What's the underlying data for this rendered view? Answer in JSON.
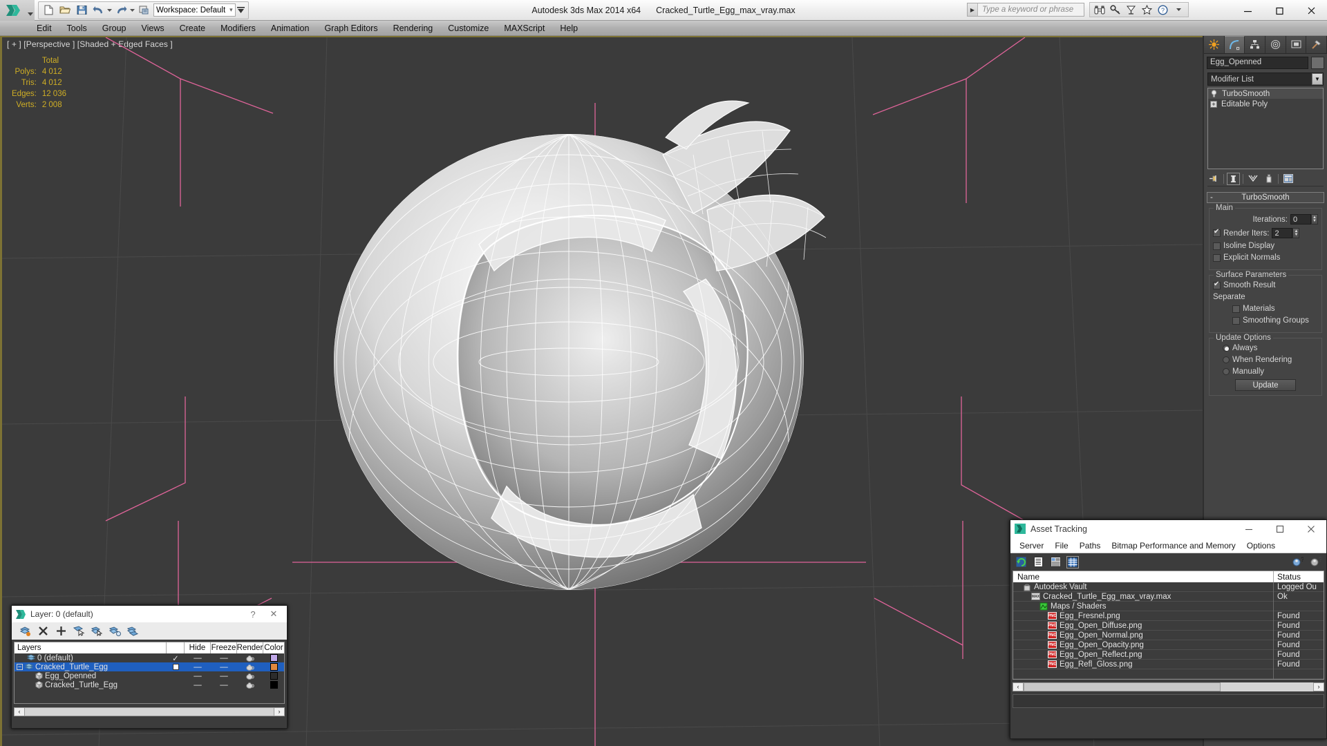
{
  "titlebar": {
    "app_title": "Autodesk 3ds Max  2014 x64",
    "file_title": "Cracked_Turtle_Egg_max_vray.max",
    "workspace_label": "Workspace: Default",
    "search_placeholder": "Type a keyword or phrase",
    "quick_access": [
      {
        "name": "new-file",
        "glyph": "new"
      },
      {
        "name": "open-file",
        "glyph": "open"
      },
      {
        "name": "save-file",
        "glyph": "save"
      },
      {
        "name": "undo",
        "glyph": "undo"
      },
      {
        "name": "redo",
        "glyph": "redo"
      },
      {
        "name": "set-project-folder",
        "glyph": "project"
      }
    ],
    "help_icons": [
      "binoculars-icon",
      "key-icon",
      "satellite-icon",
      "star-icon",
      "help-icon"
    ],
    "window_controls": [
      "minimize",
      "maximize",
      "close"
    ]
  },
  "menubar": {
    "items": [
      "Edit",
      "Tools",
      "Group",
      "Views",
      "Create",
      "Modifiers",
      "Animation",
      "Graph Editors",
      "Rendering",
      "Customize",
      "MAXScript",
      "Help"
    ]
  },
  "viewport": {
    "label": "[ + ] [Perspective ] [Shaded + Edged Faces ]",
    "stats_header": "Total",
    "stats": [
      {
        "label": "Polys:",
        "value": "4 012"
      },
      {
        "label": "Tris:",
        "value": "4 012"
      },
      {
        "label": "Edges:",
        "value": "12 036"
      },
      {
        "label": "Verts:",
        "value": "2 008"
      }
    ],
    "stats_color": "#cfae25",
    "background_color": "#3b3b3b",
    "grid_color": "#4a4a4a",
    "highlight_color": "#e0649a"
  },
  "command_panel": {
    "tabs": [
      "create-tab",
      "modify-tab",
      "hierarchy-tab",
      "motion-tab",
      "display-tab",
      "utilities-tab"
    ],
    "selected_tab_index": 1,
    "object_name": "Egg_Openned",
    "modifier_list_label": "Modifier List",
    "stack": [
      {
        "label": "TurboSmooth",
        "selected": true
      },
      {
        "label": "Editable Poly",
        "selected": false
      }
    ],
    "stack_buttons": [
      "pin-stack-icon",
      "show-end-result-icon",
      "make-unique-icon",
      "remove-modifier-icon",
      "configure-modifier-sets-icon"
    ],
    "rollout": {
      "title": "TurboSmooth",
      "collapse_glyph": "-",
      "main_group": "Main",
      "iterations_label": "Iterations:",
      "iterations_value": "0",
      "render_iters_label": "Render Iters:",
      "render_iters_value": "2",
      "render_iters_checked": true,
      "isoline_label": "Isoline Display",
      "isoline_checked": false,
      "explicit_normals_label": "Explicit Normals",
      "explicit_normals_checked": false,
      "surface_group": "Surface Parameters",
      "smooth_result_label": "Smooth Result",
      "smooth_result_checked": true,
      "separate_label": "Separate",
      "materials_label": "Materials",
      "materials_checked": false,
      "smoothing_groups_label": "Smoothing Groups",
      "smoothing_groups_checked": false,
      "update_group": "Update Options",
      "update_options": [
        {
          "label": "Always",
          "selected": true
        },
        {
          "label": "When Rendering",
          "selected": false
        },
        {
          "label": "Manually",
          "selected": false
        }
      ],
      "update_button": "Update"
    }
  },
  "layer_dialog": {
    "title": "Layer: 0 (default)",
    "help_glyph": "?",
    "close_glyph": "✕",
    "tools": [
      "create-new-layer-icon",
      "delete-layer-icon",
      "add-selection-icon",
      "select-objects-in-layer-icon",
      "select-highlighted-objects-icon",
      "highlight-selected-objects-icon",
      "layer-properties-icon"
    ],
    "columns": [
      "Layers",
      "",
      "Hide",
      "Freeze",
      "Render",
      "Color"
    ],
    "rows": [
      {
        "name": "0 (default)",
        "indent": 1,
        "type": "layer",
        "current": true,
        "hide": "—",
        "freeze": "—",
        "render": "teapot",
        "color": "#c0a8e8",
        "selected": false
      },
      {
        "name": "Cracked_Turtle_Egg",
        "indent": 0,
        "type": "layer",
        "current": false,
        "hide": "—",
        "freeze": "—",
        "render": "teapot",
        "color": "#e08840",
        "selected": true,
        "expand": "−"
      },
      {
        "name": "Egg_Openned",
        "indent": 2,
        "type": "object",
        "hide": "—",
        "freeze": "—",
        "render": "teapot",
        "color": "#2c2c2c",
        "selected": false
      },
      {
        "name": "Cracked_Turtle_Egg",
        "indent": 2,
        "type": "object",
        "hide": "—",
        "freeze": "—",
        "render": "teapot",
        "color": "#000000",
        "selected": false
      }
    ]
  },
  "asset_tracking": {
    "title": "Asset Tracking",
    "menu": [
      "Server",
      "File",
      "Paths",
      "Bitmap Performance and Memory",
      "Options"
    ],
    "toolbar": [
      "refresh-icon",
      "list-view-icon",
      "details-view-icon",
      "grid-view-icon"
    ],
    "toolbar_selected_index": 3,
    "toolbar_right": [
      "vault-login-icon",
      "vault-help-icon"
    ],
    "columns": [
      "Name",
      "Status"
    ],
    "rows": [
      {
        "name": "Autodesk Vault",
        "status": "Logged Ou",
        "indent": 0,
        "icon": "vault-icon"
      },
      {
        "name": "Cracked_Turtle_Egg_max_vray.max",
        "status": "Ok",
        "indent": 1,
        "icon": "max-file-icon"
      },
      {
        "name": "Maps / Shaders",
        "status": "",
        "indent": 2,
        "icon": "maps-icon"
      },
      {
        "name": "Egg_Fresnel.png",
        "status": "Found",
        "indent": 3,
        "icon": "png-icon"
      },
      {
        "name": "Egg_Open_Diffuse.png",
        "status": "Found",
        "indent": 3,
        "icon": "png-icon"
      },
      {
        "name": "Egg_Open_Normal.png",
        "status": "Found",
        "indent": 3,
        "icon": "png-icon"
      },
      {
        "name": "Egg_Open_Opacity.png",
        "status": "Found",
        "indent": 3,
        "icon": "png-icon"
      },
      {
        "name": "Egg_Open_Reflect.png",
        "status": "Found",
        "indent": 3,
        "icon": "png-icon"
      },
      {
        "name": "Egg_Refl_Gloss.png",
        "status": "Found",
        "indent": 3,
        "icon": "png-icon"
      }
    ],
    "window_controls": [
      "minimize",
      "maximize",
      "close"
    ]
  }
}
